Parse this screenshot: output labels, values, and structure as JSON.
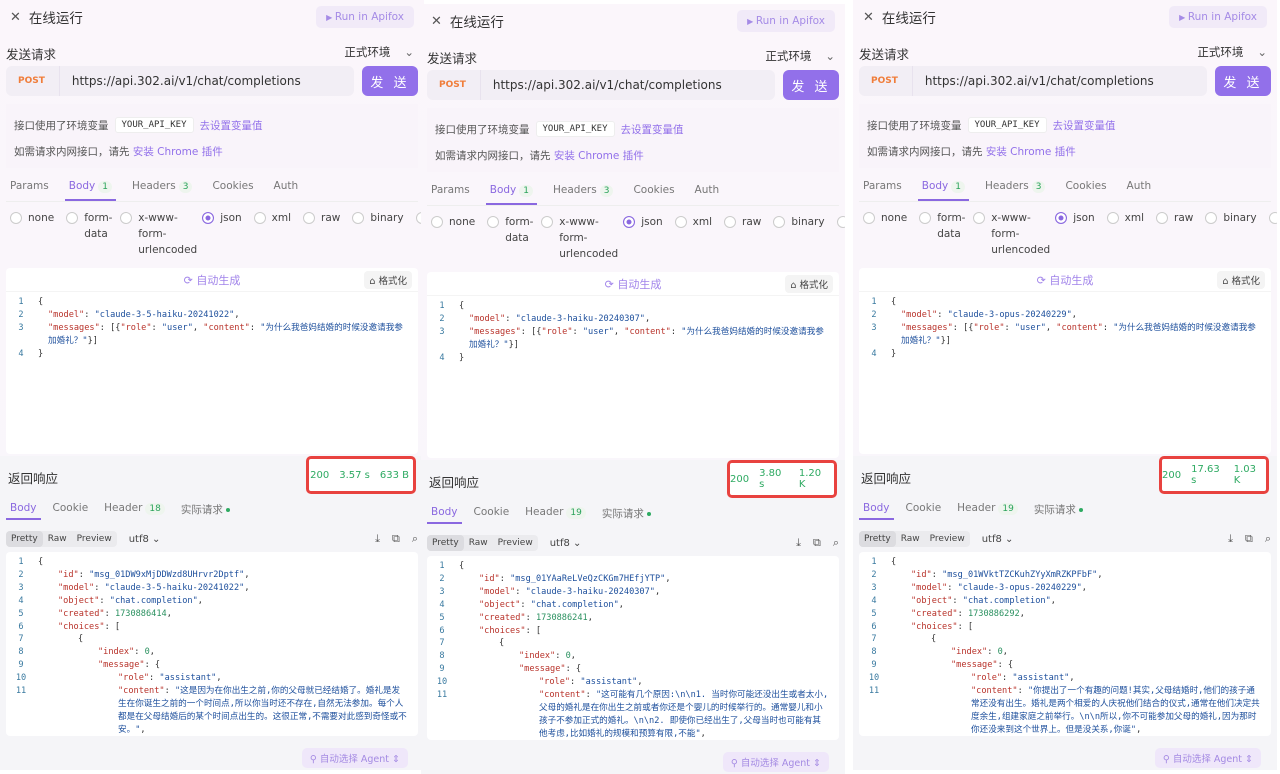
{
  "panels": [
    {
      "title": "在线运行",
      "run_label": "Run in Apifox",
      "section": "发送请求",
      "env": "正式环境",
      "method": "POST",
      "url": "https://api.302.ai/v1/chat/completions",
      "send": "发 送",
      "env_note": "接口使用了环境变量",
      "env_var": "YOUR_API_KEY",
      "env_link": "去设置变量值",
      "chrome_note": "如需请求内网接口，请先",
      "chrome_link": "安装 Chrome 插件",
      "tabs": [
        {
          "label": "Params"
        },
        {
          "label": "Body",
          "badge": "1",
          "active": true
        },
        {
          "label": "Headers",
          "badge": "3"
        },
        {
          "label": "Cookies"
        },
        {
          "label": "Auth"
        }
      ],
      "body_types": [
        {
          "label": "none"
        },
        {
          "label": "form-data"
        },
        {
          "label": "x-www-form-urlencoded"
        },
        {
          "label": "json",
          "selected": true
        },
        {
          "label": "xml"
        },
        {
          "label": "raw"
        },
        {
          "label": "binary"
        },
        {
          "label": "Gr"
        }
      ],
      "autogen": "自动生成",
      "format": "格式化",
      "req_model": "claude-3-5-haiku-20241022",
      "req_content": "为什么我爸妈结婚的时候没邀请我参加婚礼？",
      "resp_title": "返回响应",
      "status": "200",
      "time": "3.57 s",
      "size": "633 B",
      "resp_tabs": [
        {
          "label": "Body",
          "active": true
        },
        {
          "label": "Cookie"
        },
        {
          "label": "Header",
          "badge": "18"
        },
        {
          "label": "实际请求",
          "dot": true
        }
      ],
      "views": [
        "Pretty",
        "Raw",
        "Preview"
      ],
      "encoding": "utf8",
      "resp": {
        "id": "msg_01DW9xMjDDWzd8UHrvr2Dptf",
        "model": "claude-3-5-haiku-20241022",
        "object": "chat.completion",
        "created": "1730886414",
        "index": "0",
        "role": "assistant",
        "content": "这是因为在你出生之前,你的父母就已经结婚了。婚礼是发生在你诞生之前的一个时间点,所以你当时还不存在,自然无法参加。每个人都是在父母结婚后的某个时间点出生的。这很正常,不需要对此感到奇怪或不安。"
      },
      "agent": "自动选择 Agent"
    },
    {
      "title": "在线运行",
      "run_label": "Run in Apifox",
      "section": "发送请求",
      "env": "正式环境",
      "method": "POST",
      "url": "https://api.302.ai/v1/chat/completions",
      "send": "发 送",
      "env_note": "接口使用了环境变量",
      "env_var": "YOUR_API_KEY",
      "env_link": "去设置变量值",
      "chrome_note": "如需请求内网接口，请先",
      "chrome_link": "安装 Chrome 插件",
      "tabs": [
        {
          "label": "Params"
        },
        {
          "label": "Body",
          "badge": "1",
          "active": true
        },
        {
          "label": "Headers",
          "badge": "3"
        },
        {
          "label": "Cookies"
        },
        {
          "label": "Auth"
        }
      ],
      "body_types": [
        {
          "label": "none"
        },
        {
          "label": "form-data"
        },
        {
          "label": "x-www-form-urlencoded"
        },
        {
          "label": "json",
          "selected": true
        },
        {
          "label": "xml"
        },
        {
          "label": "raw"
        },
        {
          "label": "binary"
        },
        {
          "label": "Gr"
        }
      ],
      "autogen": "自动生成",
      "format": "格式化",
      "req_model": "claude-3-haiku-20240307",
      "req_content": "为什么我爸妈结婚的时候没邀请我参加婚礼？",
      "resp_title": "返回响应",
      "status": "200",
      "time": "3.80 s",
      "size": "1.20 K",
      "resp_tabs": [
        {
          "label": "Body",
          "active": true
        },
        {
          "label": "Cookie"
        },
        {
          "label": "Header",
          "badge": "19"
        },
        {
          "label": "实际请求",
          "dot": true
        }
      ],
      "views": [
        "Pretty",
        "Raw",
        "Preview"
      ],
      "encoding": "utf8",
      "resp": {
        "id": "msg_01YAaReLVeQzCKGm7HEfjYTP",
        "model": "claude-3-haiku-20240307",
        "object": "chat.completion",
        "created": "1730886241",
        "index": "0",
        "role": "assistant",
        "content": "这可能有几个原因:\\n\\n1. 当时你可能还没出生或者太小,父母的婚礼是在你出生之前或者你还是个婴儿的时候举行的。通常婴儿和小孩子不参加正式的婚礼。\\n\\n2. 即使你已经出生了,父母当时也可能有其他考虑,比如婚礼的规模和预算有限,不能"
      },
      "agent": "自动选择 Agent"
    },
    {
      "title": "在线运行",
      "run_label": "Run in Apifox",
      "section": "发送请求",
      "env": "正式环境",
      "method": "POST",
      "url": "https://api.302.ai/v1/chat/completions",
      "send": "发 送",
      "env_note": "接口使用了环境变量",
      "env_var": "YOUR_API_KEY",
      "env_link": "去设置变量值",
      "chrome_note": "如需请求内网接口，请先",
      "chrome_link": "安装 Chrome 插件",
      "tabs": [
        {
          "label": "Params"
        },
        {
          "label": "Body",
          "badge": "1",
          "active": true
        },
        {
          "label": "Headers",
          "badge": "3"
        },
        {
          "label": "Cookies"
        },
        {
          "label": "Auth"
        }
      ],
      "body_types": [
        {
          "label": "none"
        },
        {
          "label": "form-data"
        },
        {
          "label": "x-www-form-urlencoded"
        },
        {
          "label": "json",
          "selected": true
        },
        {
          "label": "xml"
        },
        {
          "label": "raw"
        },
        {
          "label": "binary"
        },
        {
          "label": "Gr"
        }
      ],
      "autogen": "自动生成",
      "format": "格式化",
      "req_model": "claude-3-opus-20240229",
      "req_content": "为什么我爸妈结婚的时候没邀请我参加婚礼？",
      "resp_title": "返回响应",
      "status": "200",
      "time": "17.63 s",
      "size": "1.03 K",
      "resp_tabs": [
        {
          "label": "Body",
          "active": true
        },
        {
          "label": "Cookie"
        },
        {
          "label": "Header",
          "badge": "19"
        },
        {
          "label": "实际请求",
          "dot": true
        }
      ],
      "views": [
        "Pretty",
        "Raw",
        "Preview"
      ],
      "encoding": "utf8",
      "resp": {
        "id": "msg_01WVktTZCKuhZYyXmRZKPFbF",
        "model": "claude-3-opus-20240229",
        "object": "chat.completion",
        "created": "1730886292",
        "index": "0",
        "role": "assistant",
        "content": "你提出了一个有趣的问题!其实,父母结婚时,他们的孩子通常还没有出生。婚礼是两个相爱的人庆祝他们结合的仪式,通常在他们决定共度余生,组建家庭之前举行。\\n\\n所以,你不可能参加父母的婚礼,因为那时你还没来到这个世界上。但是没关系,你诞"
      },
      "agent": "自动选择 Agent"
    }
  ],
  "colors": {
    "accent": "#8a68e0",
    "send": "#9270ea",
    "status_ok": "#2eaa62",
    "highlight_box": "#e8423f",
    "method_post": "#f07d3a"
  }
}
